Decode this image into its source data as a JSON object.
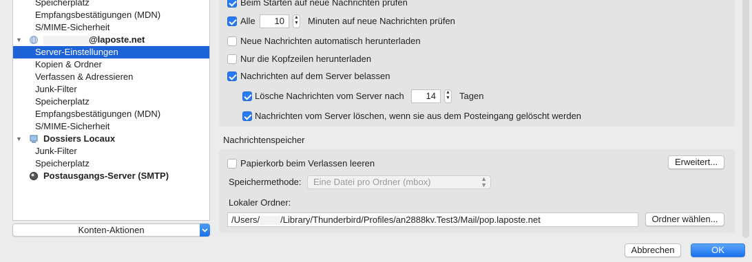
{
  "sidebar": {
    "rows": [
      {
        "label": "Speicherplatz"
      },
      {
        "label": "Empfangsbestätigungen (MDN)"
      },
      {
        "label": "S/MIME-Sicherheit"
      },
      {
        "label": "@laposte.net"
      },
      {
        "label": "Server-Einstellungen"
      },
      {
        "label": "Kopien & Ordner"
      },
      {
        "label": "Verfassen & Adressieren"
      },
      {
        "label": "Junk-Filter"
      },
      {
        "label": "Speicherplatz"
      },
      {
        "label": "Empfangsbestätigungen (MDN)"
      },
      {
        "label": "S/MIME-Sicherheit"
      },
      {
        "label": "Dossiers Locaux"
      },
      {
        "label": "Junk-Filter"
      },
      {
        "label": "Speicherplatz"
      },
      {
        "label": "Postausgangs-Server (SMTP)"
      }
    ],
    "konten_aktionen": "Konten-Aktionen",
    "selected_index": 4
  },
  "server": {
    "check_on_startup": "Beim Starten auf neue Nachrichten prüfen",
    "check_every_label": "Alle",
    "check_every_value": "10",
    "check_every_suffix": "Minuten auf neue Nachrichten prüfen",
    "auto_download": "Neue Nachrichten automatisch herunterladen",
    "headers_only": "Nur die Kopfzeilen herunterladen",
    "leave_on_server": "Nachrichten auf dem Server belassen",
    "delete_after_label": "Lösche Nachrichten vom Server nach",
    "delete_after_value": "14",
    "delete_after_suffix": "Tagen",
    "delete_when_deleted": "Nachrichten vom Server löschen, wenn sie aus dem Posteingang gelöscht werden"
  },
  "storage": {
    "section_title": "Nachrichtenspeicher",
    "empty_trash": "Papierkorb beim Verlassen leeren",
    "advanced_button": "Erweitert...",
    "method_label": "Speichermethode:",
    "method_value": "Eine Datei pro Ordner (mbox)",
    "local_folder_label": "Lokaler Ordner:",
    "path_prefix": "/Users/",
    "path_suffix": "/Library/Thunderbird/Profiles/an2888kv.Test3/Mail/pop.laposte.net",
    "choose_folder_button": "Ordner wählen..."
  },
  "footer": {
    "cancel_button": "Abbrechen",
    "ok_button": "OK"
  },
  "colors": {
    "accent": "#1d63d8",
    "checkbox": "#2a7bf3"
  }
}
